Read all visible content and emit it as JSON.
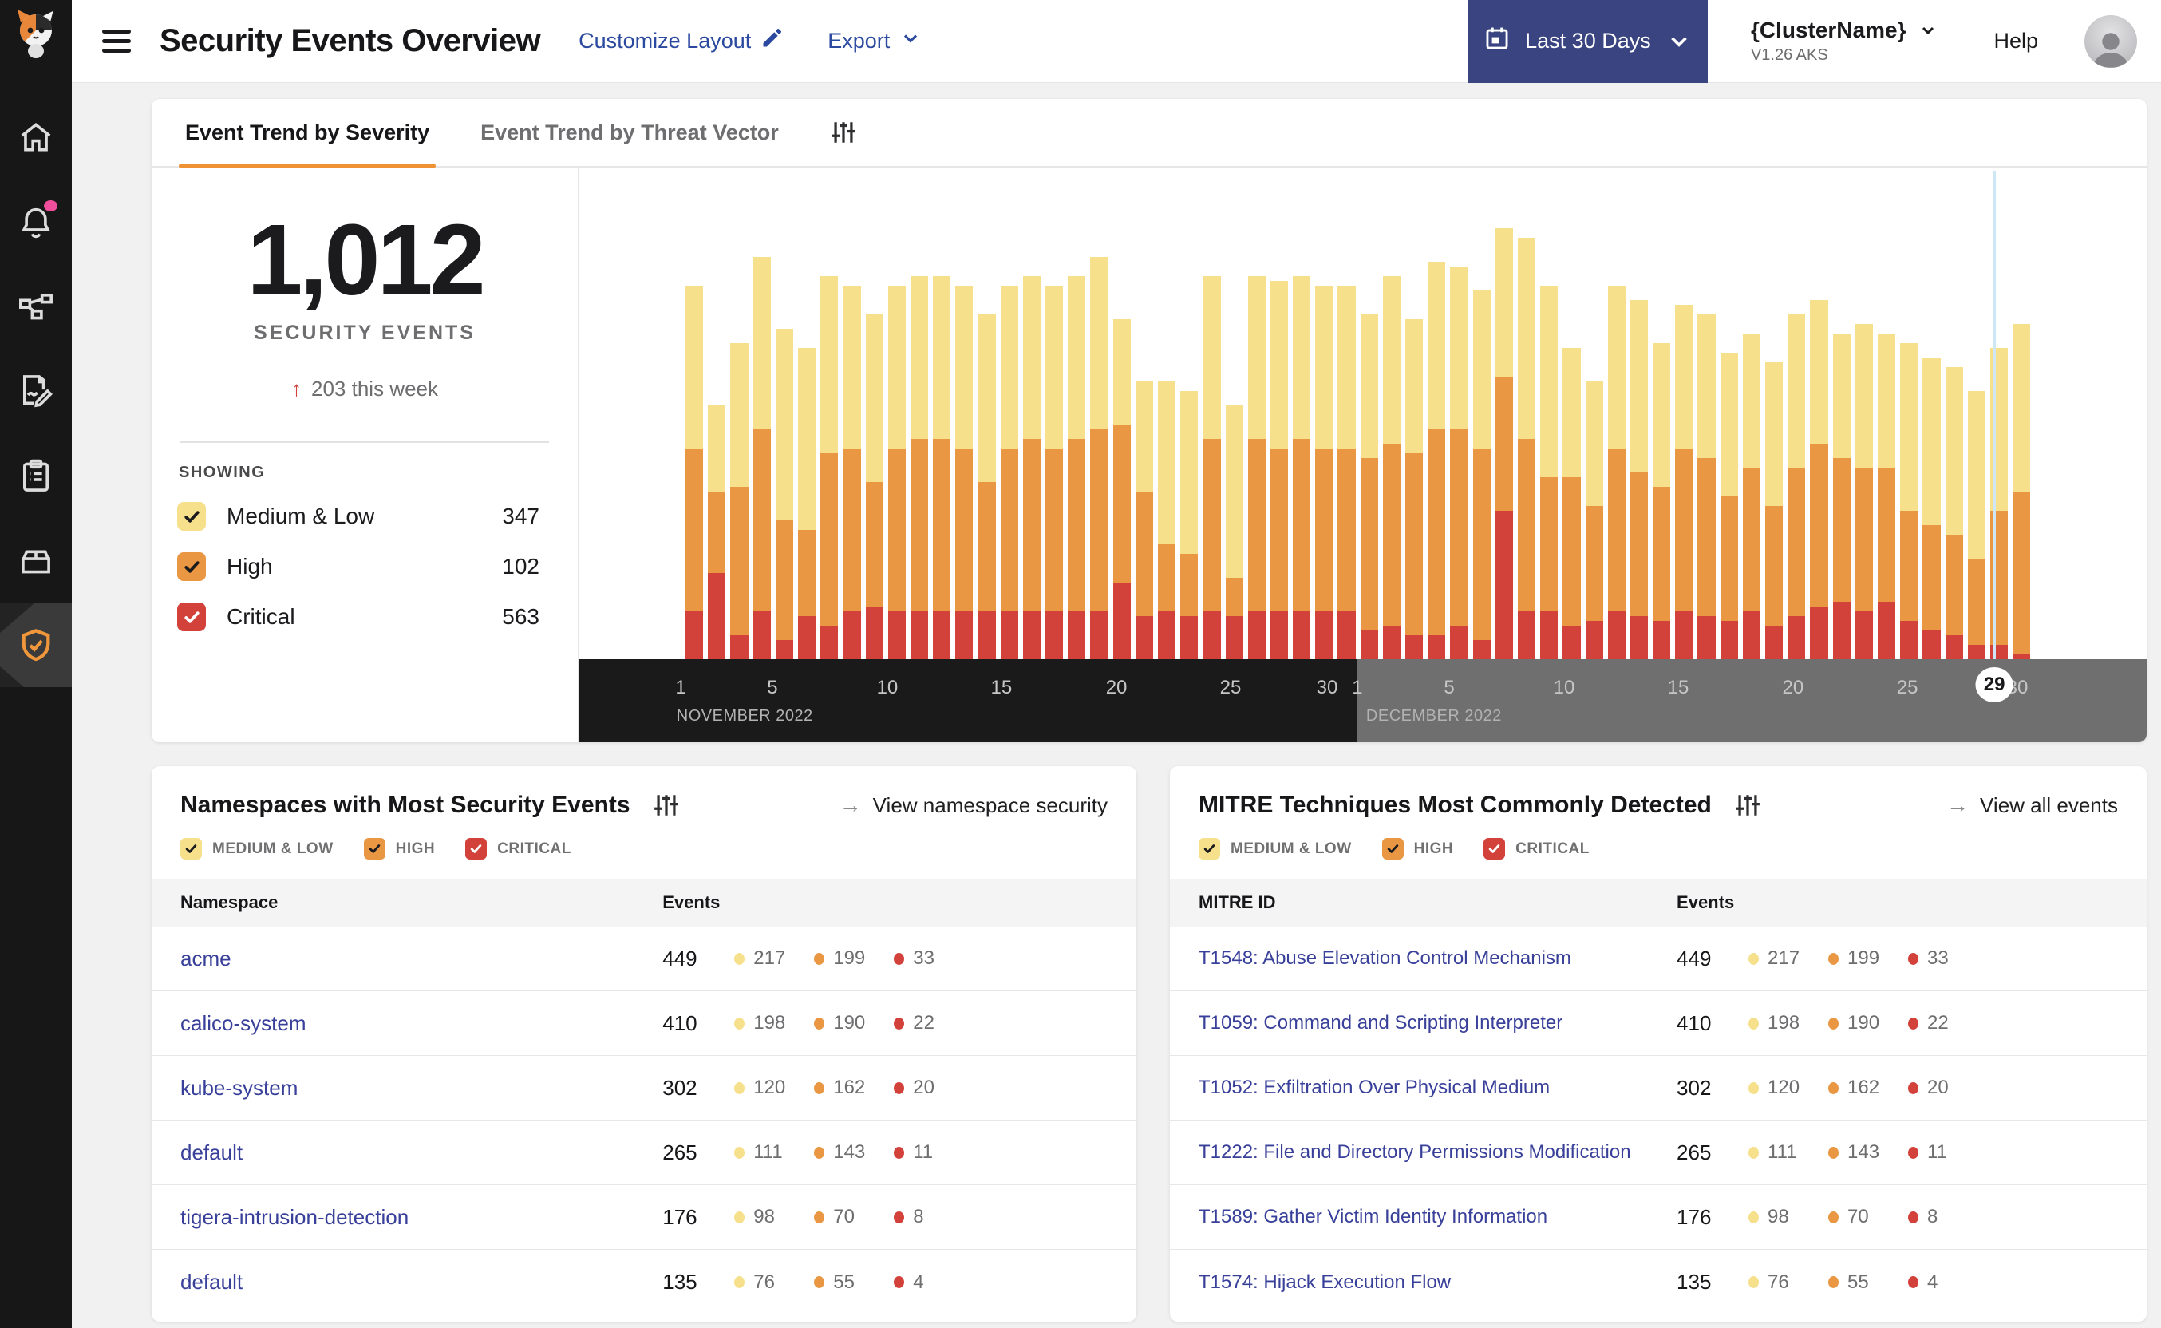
{
  "colors": {
    "medium_low": "#f6e08c",
    "high": "#e99742",
    "critical": "#d2413a",
    "accent_orange": "#ef9234",
    "brand_blue": "#2b4a9f",
    "link_indigo": "#39409a",
    "button_navy": "#3a4480",
    "notification_pink": "#ef4f9a",
    "axis_november_bg": "#1a1a1a",
    "axis_december_bg": "#6f6f6f",
    "current_day_line": "#cfe7f4"
  },
  "sidebar": {
    "items": [
      {
        "icon": "home-icon",
        "active": false,
        "badge": false
      },
      {
        "icon": "bell-icon",
        "active": false,
        "badge": true
      },
      {
        "icon": "service-graph-icon",
        "active": false,
        "badge": false
      },
      {
        "icon": "policy-edit-icon",
        "active": false,
        "badge": false
      },
      {
        "icon": "clipboard-icon",
        "active": false,
        "badge": false
      },
      {
        "icon": "box-icon",
        "active": false,
        "badge": false
      },
      {
        "icon": "shield-check-icon",
        "active": true,
        "badge": false
      }
    ]
  },
  "header": {
    "title": "Security Events Overview",
    "customize_label": "Customize Layout",
    "export_label": "Export",
    "date_range_label": "Last 30 Days",
    "cluster_name": "{ClusterName}",
    "cluster_version": "V1.26 AKS",
    "help_label": "Help"
  },
  "trend_card": {
    "tabs": [
      {
        "label": "Event Trend by Severity",
        "active": true
      },
      {
        "label": "Event Trend by Threat Vector",
        "active": false
      }
    ],
    "stat": {
      "value": "1,012",
      "label": "SECURITY EVENTS",
      "week_delta_arrow": "↑",
      "week_delta": "203 this week"
    },
    "showing_label": "SHOWING",
    "legend": [
      {
        "label": "Medium & Low",
        "count": "347",
        "box_color": "#f6e08c",
        "check_color": "#1b1b1e"
      },
      {
        "label": "High",
        "count": "102",
        "box_color": "#e99742",
        "check_color": "#1b1b1e"
      },
      {
        "label": "Critical",
        "count": "563",
        "box_color": "#d2413a",
        "check_color": "#ffffff"
      }
    ]
  },
  "severity_filters": [
    {
      "label": "MEDIUM & LOW",
      "box_color": "#f6e08c",
      "check_color": "#1b1b1e"
    },
    {
      "label": "HIGH",
      "box_color": "#e99742",
      "check_color": "#1b1b1e"
    },
    {
      "label": "CRITICAL",
      "box_color": "#d2413a",
      "check_color": "#ffffff"
    }
  ],
  "chart_data": {
    "type": "bar",
    "stacked": true,
    "title": "Event Trend by Severity",
    "x_unit": "day (Nov 1 2022 – Dec 30 2022)",
    "y_unit": "percent of plot height (no y-axis shown)",
    "months": [
      {
        "label": "NOVEMBER 2022",
        "days": 30,
        "bg": "#1a1a1a",
        "label_pct": 6.2
      },
      {
        "label": "DECEMBER 2022",
        "days": 30,
        "bg": "#6f6f6f",
        "label_pct": 50.2
      }
    ],
    "month_split_pct": 49.6,
    "series": [
      {
        "name": "Medium & Low",
        "color": "#f6e08c",
        "values": [
          34,
          18,
          30,
          36,
          40,
          38,
          37,
          34,
          35,
          34,
          34,
          34,
          34,
          35,
          34,
          34,
          34,
          34,
          36,
          22,
          23,
          34,
          34,
          34,
          36,
          34,
          35,
          34,
          34,
          34,
          30,
          35,
          28,
          35,
          34,
          33,
          31,
          42,
          40,
          27,
          26,
          34,
          36,
          30,
          30,
          30,
          30,
          28,
          30,
          32,
          30,
          26,
          30,
          28,
          35,
          35,
          35,
          35,
          34,
          35
        ]
      },
      {
        "name": "High",
        "color": "#e99742",
        "values": [
          34,
          17,
          31,
          38,
          25,
          18,
          36,
          34,
          26,
          34,
          36,
          36,
          34,
          27,
          34,
          36,
          34,
          36,
          38,
          33,
          26,
          14,
          13,
          36,
          8,
          36,
          34,
          36,
          34,
          34,
          36,
          38,
          38,
          43,
          41,
          40,
          28,
          36,
          28,
          31,
          24,
          34,
          30,
          28,
          34,
          33,
          26,
          30,
          25,
          31,
          34,
          30,
          30,
          28,
          23,
          22,
          21,
          18,
          28,
          34
        ]
      },
      {
        "name": "Critical",
        "color": "#d2413a",
        "values": [
          10,
          18,
          5,
          10,
          4,
          9,
          7,
          10,
          11,
          10,
          10,
          10,
          10,
          10,
          10,
          10,
          10,
          10,
          10,
          16,
          9,
          10,
          9,
          10,
          9,
          10,
          10,
          10,
          10,
          10,
          6,
          7,
          5,
          5,
          7,
          4,
          31,
          10,
          10,
          7,
          8,
          10,
          9,
          8,
          10,
          9,
          8,
          10,
          7,
          9,
          11,
          12,
          10,
          12,
          8,
          6,
          5,
          3,
          3,
          1
        ]
      }
    ],
    "axis_ticks": [
      {
        "label": "1",
        "pct": 6.47,
        "highlighted": false
      },
      {
        "label": "5",
        "pct": 12.32,
        "highlighted": false
      },
      {
        "label": "10",
        "pct": 19.65,
        "highlighted": false
      },
      {
        "label": "15",
        "pct": 26.93,
        "highlighted": false
      },
      {
        "label": "20",
        "pct": 34.27,
        "highlighted": false
      },
      {
        "label": "25",
        "pct": 41.55,
        "highlighted": false
      },
      {
        "label": "30",
        "pct": 47.71,
        "highlighted": false
      },
      {
        "label": "1",
        "pct": 49.64,
        "highlighted": false
      },
      {
        "label": "5",
        "pct": 55.5,
        "highlighted": false
      },
      {
        "label": "10",
        "pct": 62.83,
        "highlighted": false
      },
      {
        "label": "15",
        "pct": 70.11,
        "highlighted": false
      },
      {
        "label": "20",
        "pct": 77.44,
        "highlighted": false
      },
      {
        "label": "25",
        "pct": 84.73,
        "highlighted": false
      },
      {
        "label": "30",
        "pct": 91.75,
        "highlighted": false
      },
      {
        "label": "29",
        "pct": 90.28,
        "highlighted": true
      }
    ],
    "current_day_marker": {
      "label": "29",
      "pct": 90.2
    }
  },
  "namespaces_card": {
    "title": "Namespaces with Most Security Events",
    "link_label": "View namespace security",
    "link_arrow": "→",
    "columns": {
      "name": "Namespace",
      "events": "Events"
    },
    "rows": [
      {
        "name": "acme",
        "total": "449",
        "medium_low": "217",
        "high": "199",
        "critical": "33"
      },
      {
        "name": "calico-system",
        "total": "410",
        "medium_low": "198",
        "high": "190",
        "critical": "22"
      },
      {
        "name": "kube-system",
        "total": "302",
        "medium_low": "120",
        "high": "162",
        "critical": "20"
      },
      {
        "name": "default",
        "total": "265",
        "medium_low": "111",
        "high": "143",
        "critical": "11"
      },
      {
        "name": "tigera-intrusion-detection",
        "total": "176",
        "medium_low": "98",
        "high": "70",
        "critical": "8"
      },
      {
        "name": "default",
        "total": "135",
        "medium_low": "76",
        "high": "55",
        "critical": "4"
      }
    ]
  },
  "mitre_card": {
    "title": "MITRE Techniques Most Commonly Detected",
    "link_label": "View all events",
    "link_arrow": "→",
    "columns": {
      "name": "MITRE ID",
      "events": "Events"
    },
    "rows": [
      {
        "name": "T1548: Abuse Elevation Control Mechanism",
        "total": "449",
        "medium_low": "217",
        "high": "199",
        "critical": "33"
      },
      {
        "name": "T1059: Command and Scripting Interpreter",
        "total": "410",
        "medium_low": "198",
        "high": "190",
        "critical": "22"
      },
      {
        "name": "T1052: Exfiltration Over Physical Medium",
        "total": "302",
        "medium_low": "120",
        "high": "162",
        "critical": "20"
      },
      {
        "name": "T1222: File and Directory Permissions Modification",
        "total": "265",
        "medium_low": "111",
        "high": "143",
        "critical": "11"
      },
      {
        "name": "T1589: Gather Victim Identity Information",
        "total": "176",
        "medium_low": "98",
        "high": "70",
        "critical": "8"
      },
      {
        "name": "T1574: Hijack Execution Flow",
        "total": "135",
        "medium_low": "76",
        "high": "55",
        "critical": "4"
      }
    ]
  }
}
